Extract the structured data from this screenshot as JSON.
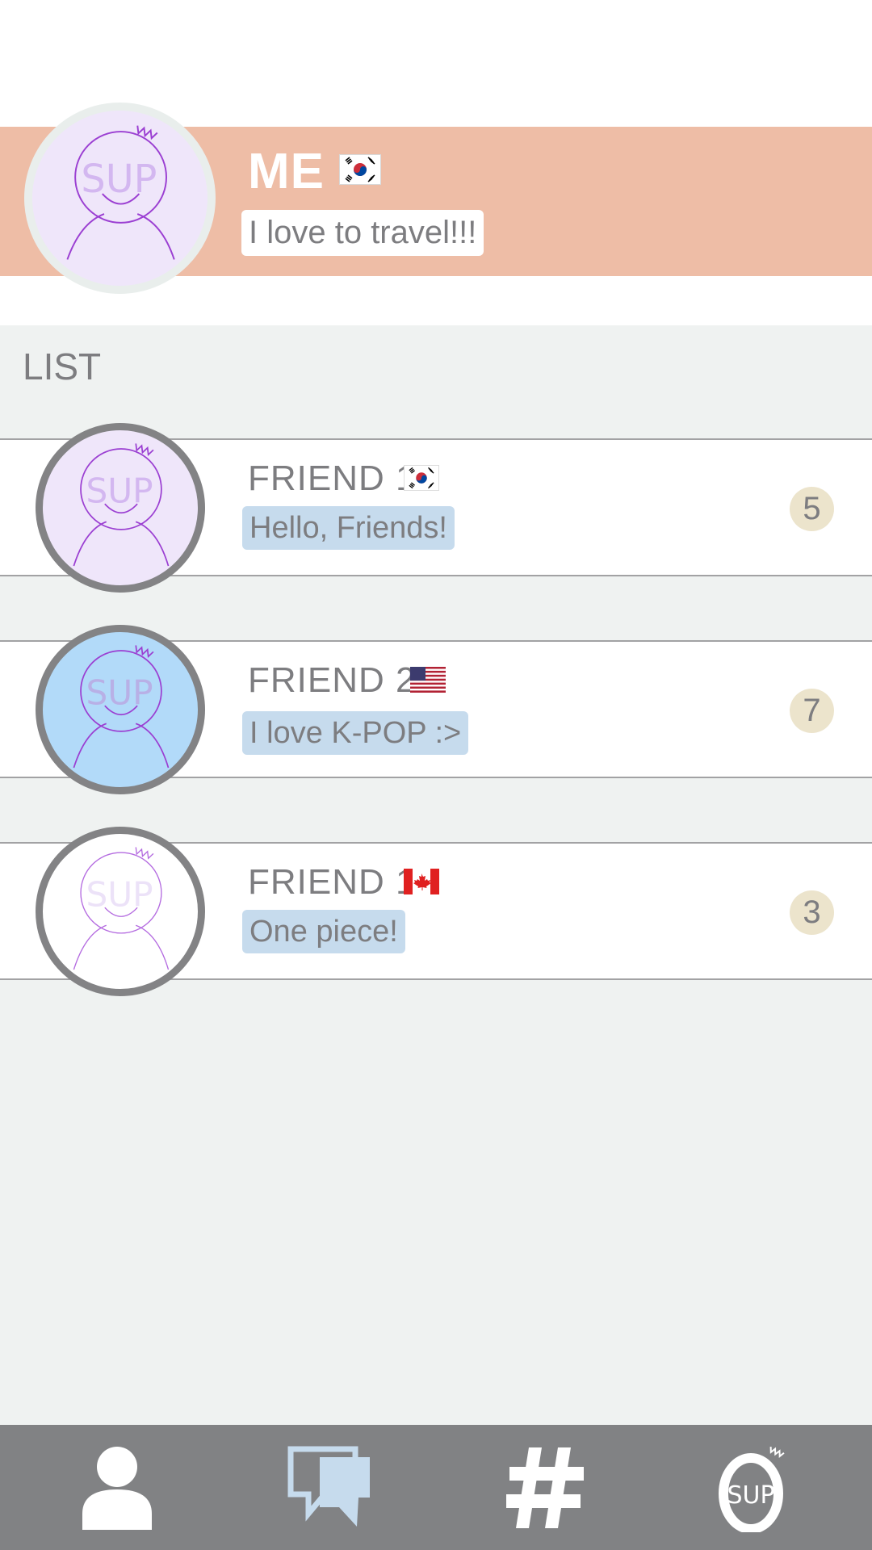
{
  "me": {
    "name": "ME",
    "country": "kr",
    "status": "I love to travel!!!",
    "avatar": {
      "text": "SUP",
      "background": "#efe6fa"
    }
  },
  "list": {
    "title": "LIST",
    "friends": [
      {
        "name": "FRIEND 1",
        "country": "kr",
        "status": "Hello, Friends!",
        "count": "5",
        "avatar": {
          "text": "SUP",
          "background": "#efe6fa"
        }
      },
      {
        "name": "FRIEND 2",
        "country": "us",
        "status": "I love K-POP :>",
        "count": "7",
        "avatar": {
          "text": "SUP",
          "background": "#b2daf9"
        }
      },
      {
        "name": "FRIEND 1",
        "country": "ca",
        "status": "One piece!",
        "count": "3",
        "avatar": {
          "text": "SUP",
          "background": "#ffffff"
        }
      }
    ]
  },
  "nav": {
    "items": [
      {
        "icon": "person-icon"
      },
      {
        "icon": "chat-icon"
      },
      {
        "icon": "hashtag-icon"
      },
      {
        "icon": "sup-logo-icon",
        "text": "SUP"
      }
    ]
  },
  "colors": {
    "profile_band": "#eebda6",
    "list_background": "#eff2f1",
    "status_bubble": "#c6dbed",
    "count_badge": "#ece4cc",
    "nav_background": "#818284",
    "text": "#7d7d80"
  }
}
